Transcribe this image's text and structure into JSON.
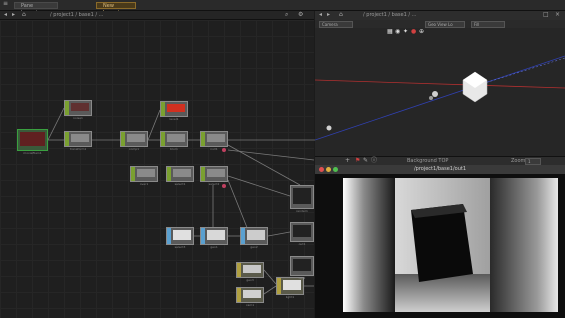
{
  "tabs": [
    {
      "label": "Pane Layout"
    },
    {
      "label": "New Layout"
    }
  ],
  "network": {
    "path": "/ project1 / base1 / ...",
    "nodes": [
      {
        "label": "moviefilein1"
      },
      {
        "label": "noise1"
      },
      {
        "label": "transform1"
      },
      {
        "label": "comp1"
      },
      {
        "label": "level1"
      },
      {
        "label": "blur1"
      },
      {
        "label": "null1"
      },
      {
        "label": "over1"
      },
      {
        "label": "select1"
      },
      {
        "label": "select2"
      },
      {
        "label": "select3"
      },
      {
        "label": "geo1"
      },
      {
        "label": "geo2"
      },
      {
        "label": "geo3"
      },
      {
        "label": "cam1"
      },
      {
        "label": "light1"
      },
      {
        "label": "render1"
      },
      {
        "label": "out1"
      },
      {
        "label": "out2"
      }
    ]
  },
  "viewer3d": {
    "path": "/ project1 / base1 / ...",
    "camera_select": "Camera",
    "view_select": "Geo View Lo",
    "mode_select": "Fill",
    "status": "Background TOP",
    "zoom_label": "Zoom",
    "zoom_value": "1"
  },
  "window": {
    "title": "/project1/base1/out1"
  },
  "colors": {
    "accent_tab": "#8a6a2a",
    "node_side": "#7aa030",
    "red_thumb": "#d03020",
    "top_node": "#5aa0d0"
  }
}
